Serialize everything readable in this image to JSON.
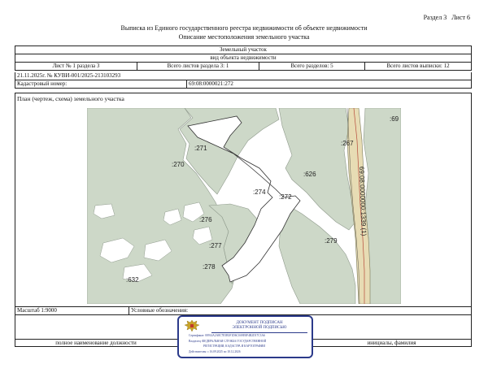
{
  "header": {
    "section_label": "Раздел 3",
    "sheet_label": "Лист 6",
    "title": "Выписка из Единого государственного реестра недвижимости об объекте недвижимости",
    "subtitle": "Описание местоположения земельного участка"
  },
  "object": {
    "type": "Земельный участок",
    "kind_caption": "вид объекта недвижимости"
  },
  "sheet_row": {
    "sheet_no": "Лист № 1 раздела 3",
    "section_sheets": "Всего листов раздела 3: 1",
    "total_sections": "Всего разделов: 5",
    "total_sheets": "Всего листов выписки: 12"
  },
  "doc": {
    "number_line": "21.11.2025г. № КУВИ-001/2025-213103293",
    "cadastral_label": "Кадастровый номер:",
    "cadastral_value": "69:08:0000021:272"
  },
  "plan": {
    "caption": "План (чертеж, схема) земельного участка",
    "labels": [
      ":271",
      ":270",
      ":274",
      ":272",
      ":276",
      ":277",
      ":278",
      ":632",
      ":626",
      ":267",
      ":279",
      ":69"
    ],
    "road_label": "69:08:0000000:1339 (1)"
  },
  "footer": {
    "scale": "Масштаб 1:9000",
    "legend_label": "Условные обозначения:",
    "position_caption": "полное наименование должности",
    "name_caption": "инициалы, фамилия"
  },
  "stamp": {
    "title_line1": "ДОКУМЕНТ ПОДПИСАН",
    "title_line2": "ЭЛЕКТРОННОЙ ПОДПИСЬЮ",
    "certificate": "Сертификат: 00914A2A8C7E5B3F1D6C0A9E8F4B2D17C3A6",
    "owner": "Владелец: ФЕДЕРАЛЬНАЯ СЛУЖБА ГОСУДАРСТВЕННОЙ",
    "owner2": "РЕГИСТРАЦИИ, КАДАСТРА И КАРТОГРАФИИ",
    "valid": "Действителен: с 16.09.2025 по 10.12.2026"
  }
}
